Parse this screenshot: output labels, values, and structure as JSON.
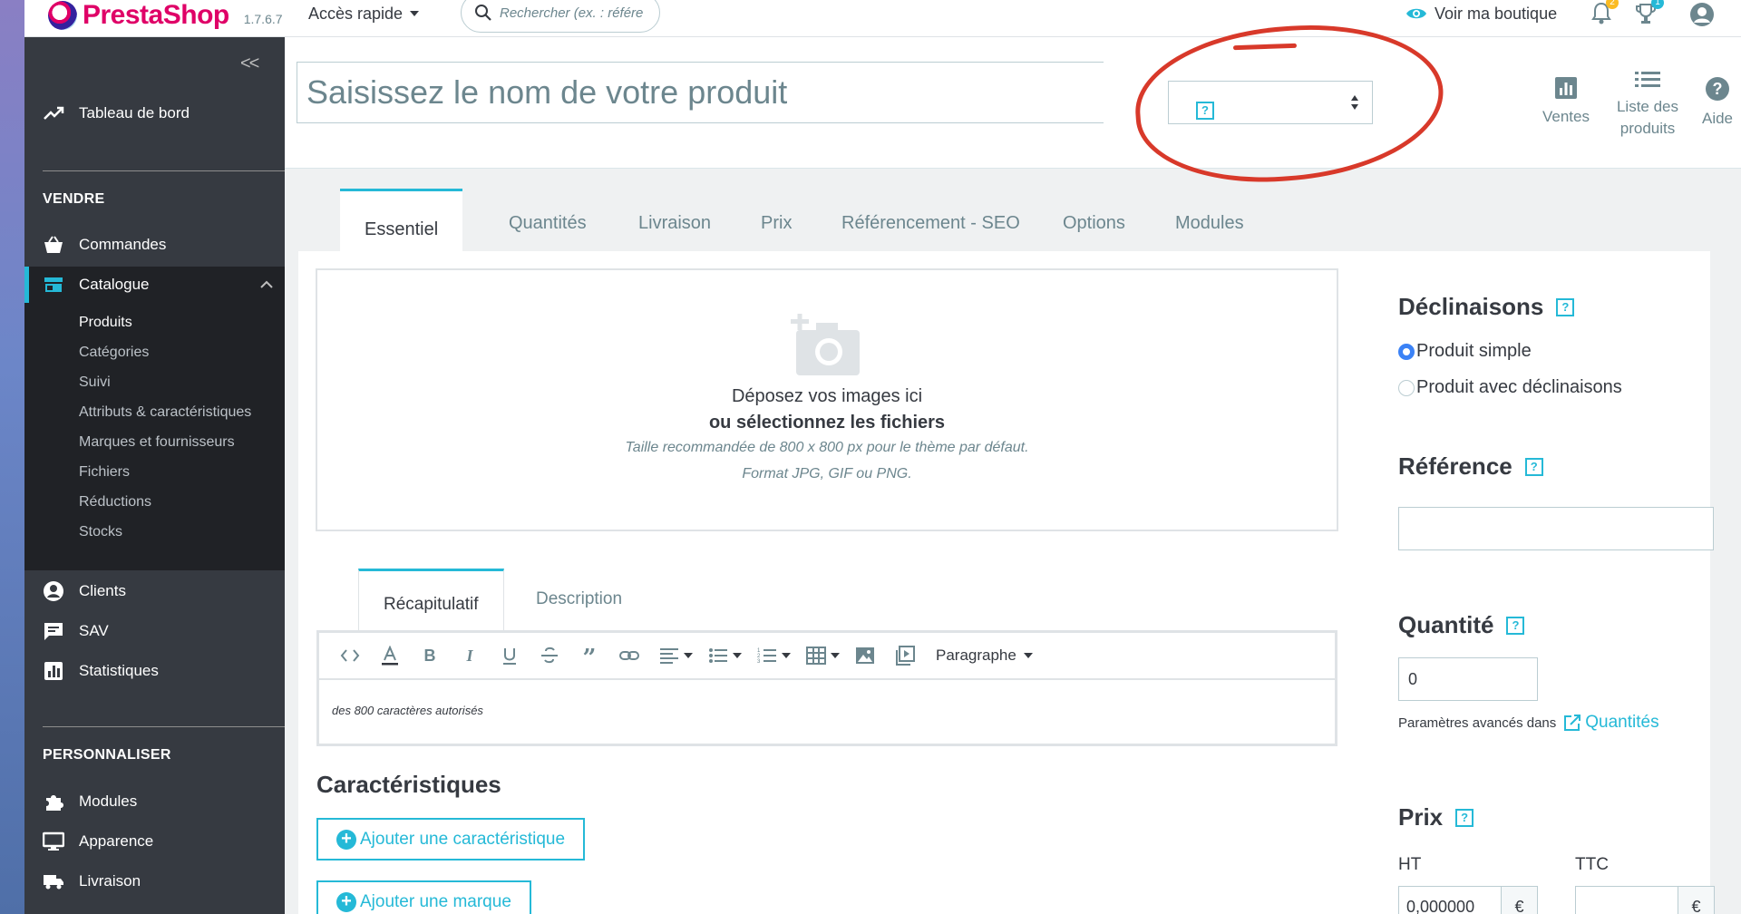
{
  "header": {
    "brand": "PrestaShop",
    "version": "1.7.6.7",
    "quick_access": "Accès rapide",
    "search_placeholder": "Rechercher (ex. : référe",
    "view_shop": "Voir ma boutique",
    "notif_count": "2",
    "trophy_count": "1"
  },
  "sidebar": {
    "dashboard": "Tableau de bord",
    "section_sell": "VENDRE",
    "orders": "Commandes",
    "catalogue": "Catalogue",
    "catalogue_items": [
      "Produits",
      "Catégories",
      "Suivi",
      "Attributs & caractéristiques",
      "Marques et fournisseurs",
      "Fichiers",
      "Réductions",
      "Stocks"
    ],
    "clients": "Clients",
    "sav": "SAV",
    "stats": "Statistiques",
    "section_customize": "PERSONNALISER",
    "modules": "Modules",
    "appearance": "Apparence",
    "shipping": "Livraison"
  },
  "topbar": {
    "product_name_placeholder": "Saisissez le nom de votre produit",
    "type_select_help": "?",
    "btn_sales": "Ventes",
    "btn_list_l1": "Liste des",
    "btn_list_l2": "produits",
    "btn_help": "Aide"
  },
  "tabs": [
    "Essentiel",
    "Quantités",
    "Livraison",
    "Prix",
    "Référencement - SEO",
    "Options",
    "Modules"
  ],
  "dropzone": {
    "line1": "Déposez vos images ici",
    "line2": "ou sélectionnez les fichiers",
    "line3": "Taille recommandée de 800 x 800 px pour le thème par défaut.",
    "line4": "Format JPG, GIF ou PNG."
  },
  "subtabs": [
    "Récapitulatif",
    "Description"
  ],
  "editor": {
    "paragraph": "Paragraphe",
    "counter_text": "des 800 caractères autorisés"
  },
  "features": {
    "title": "Caractéristiques",
    "add_feature": "Ajouter une caractéristique",
    "add_brand": "Ajouter une marque"
  },
  "right": {
    "combinations_title": "Déclinaisons",
    "simple": "Produit simple",
    "with_combinations": "Produit avec déclinaisons",
    "reference_title": "Référence",
    "reference_value": "",
    "quantity_title": "Quantité",
    "quantity_value": "0",
    "advanced_text": "Paramètres avancés dans",
    "advanced_link": "Quantités",
    "price_title": "Prix",
    "ht_label": "HT",
    "ttc_label": "TTC",
    "ht_value": "0,000000",
    "ttc_value": "",
    "currency": "€",
    "help": "?"
  },
  "colors": {
    "accent": "#25b9d7",
    "brand": "#df0067",
    "sidebar": "#363a41",
    "annotation": "#d8392a"
  }
}
